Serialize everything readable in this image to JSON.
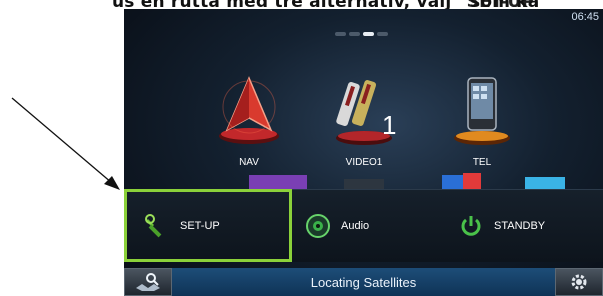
{
  "doc": {
    "text_before": "us en rutta med tre alternativ, välj",
    "text_highlight": "\"SET-UP\"",
    "text_after": "som ka"
  },
  "clock": "06:45",
  "apps": [
    {
      "label": "NAV",
      "icon": "nav-icon"
    },
    {
      "label": "VIDEO1",
      "icon": "video-icon"
    },
    {
      "label": "TEL",
      "icon": "phone-icon"
    }
  ],
  "menu": {
    "setup_label": "SET-UP",
    "audio_label": "Audio",
    "standby_label": "STANDBY"
  },
  "status": {
    "text": "Locating Satellites",
    "left_icon": "search-map-icon",
    "right_icon": "gear-icon"
  },
  "colors": {
    "highlight": "#8bd13a",
    "status_bar": "#1d4d78",
    "screen_bg": "#13202f"
  }
}
